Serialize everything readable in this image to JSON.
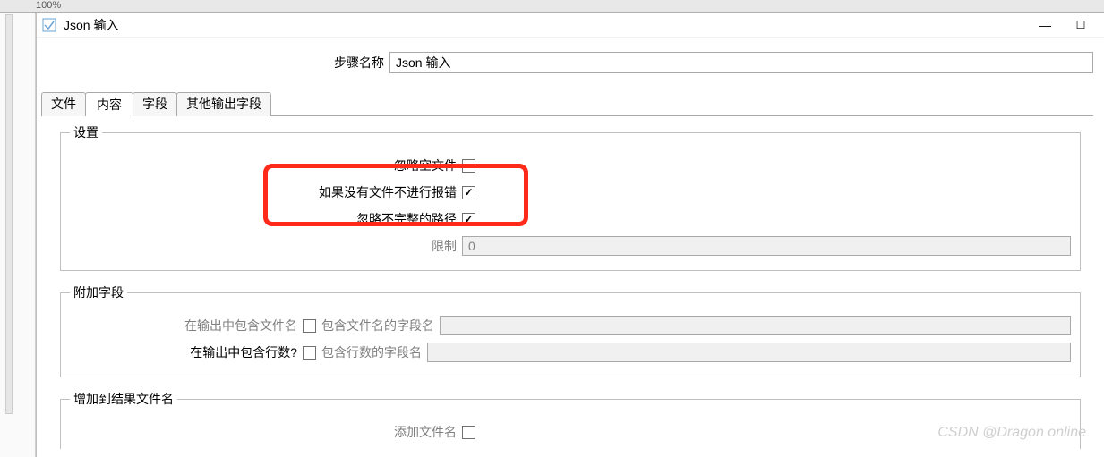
{
  "topbar_fragment": "100%",
  "dialog": {
    "title": "Json 输入",
    "stepname_label": "步骤名称",
    "stepname_value": "Json 输入"
  },
  "tabs": [
    {
      "label": "文件",
      "active": false
    },
    {
      "label": "内容",
      "active": true
    },
    {
      "label": "字段",
      "active": false
    },
    {
      "label": "其他输出字段",
      "active": false
    }
  ],
  "groups": {
    "settings": {
      "legend": "设置",
      "ignore_empty_file": {
        "label": "忽略空文件",
        "checked": false
      },
      "no_error_if_no_file": {
        "label": "如果没有文件不进行报错",
        "checked": true
      },
      "ignore_incomplete_path": {
        "label": "忽略不完整的路径",
        "checked": true
      },
      "limit": {
        "label": "限制",
        "value": "0"
      }
    },
    "additional": {
      "legend": "附加字段",
      "include_filename": {
        "label": "在输出中包含文件名",
        "checked": false,
        "sublabel": "包含文件名的字段名",
        "value": ""
      },
      "include_rownum": {
        "label": "在输出中包含行数?",
        "checked": false,
        "sublabel": "包含行数的字段名",
        "value": ""
      }
    },
    "addresult": {
      "legend": "增加到结果文件名",
      "add_filename": {
        "label": "添加文件名",
        "checked": false
      }
    }
  },
  "watermark": "CSDN @Dragon online"
}
